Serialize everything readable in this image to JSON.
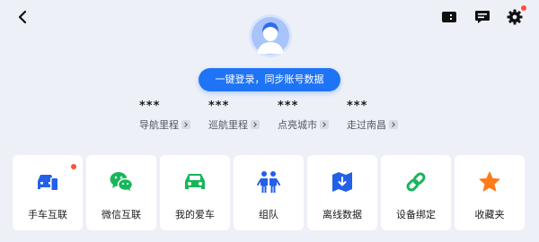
{
  "login": {
    "label": "一键登录，同步账号数据"
  },
  "stats": [
    {
      "value": "***",
      "label": "导航里程"
    },
    {
      "value": "***",
      "label": "巡航里程"
    },
    {
      "value": "***",
      "label": "点亮城市"
    },
    {
      "value": "***",
      "label": "走过南昌"
    }
  ],
  "tiles": [
    {
      "label": "手车互联",
      "icon": "car-phone-icon",
      "badge": true
    },
    {
      "label": "微信互联",
      "icon": "wechat-icon"
    },
    {
      "label": "我的爱车",
      "icon": "car-icon"
    },
    {
      "label": "组队",
      "icon": "team-icon"
    },
    {
      "label": "离线数据",
      "icon": "offline-map-icon"
    },
    {
      "label": "设备绑定",
      "icon": "link-icon"
    },
    {
      "label": "收藏夹",
      "icon": "star-icon"
    }
  ],
  "colors": {
    "background": "#eef0f8",
    "accent": "#1f74f6",
    "wechat": "#17b65b",
    "star": "#ff7a1a",
    "badge": "#ff4d3a"
  }
}
